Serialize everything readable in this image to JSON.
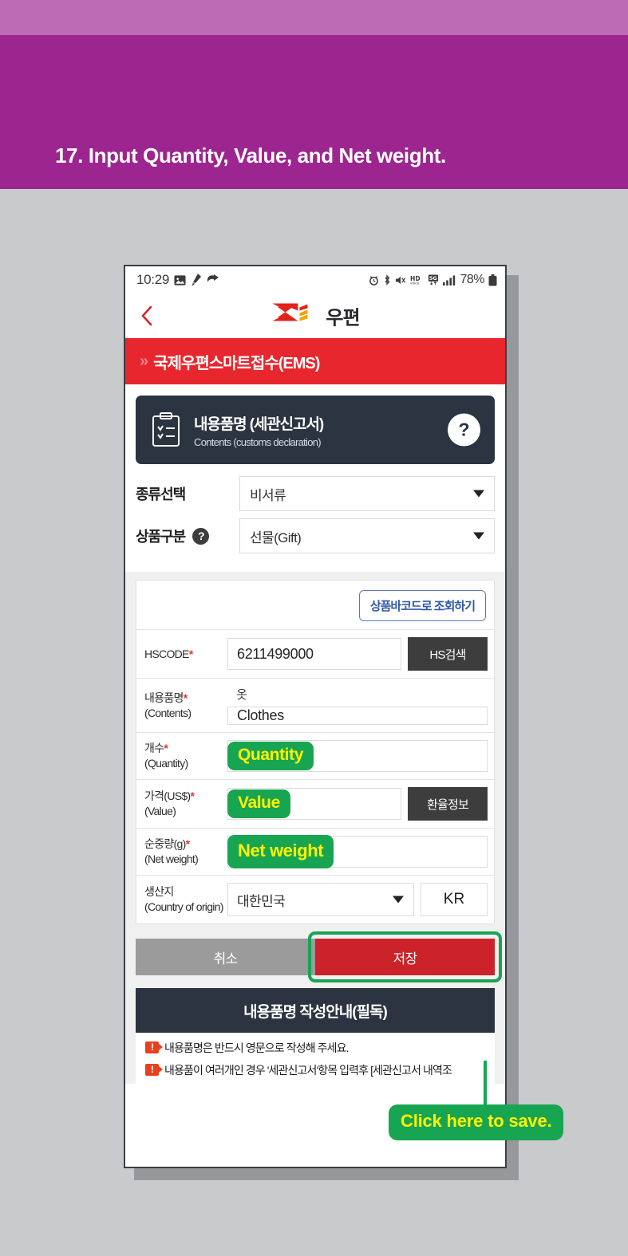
{
  "banner": {
    "title": "17. Input Quantity, Value, and Net weight."
  },
  "phone": {
    "status_bar": {
      "time": "10:29",
      "left_icons": [
        "photo-icon",
        "app-icon",
        "app-icon"
      ],
      "right_icons": [
        "alarm-icon",
        "bluetooth-icon",
        "mute-icon",
        "hd-voice-icon",
        "5g-icon",
        "signal-icon"
      ],
      "battery": "78%"
    },
    "app_bar": {
      "back_label": "‹",
      "brand_word": "우편"
    },
    "red_banner": {
      "chevrons": "»",
      "text": "국제우편스마트접수(EMS)"
    },
    "section_card": {
      "title": "내용품명 (세관신고서)",
      "subtitle": "Contents (customs declaration)",
      "help_label": "?"
    },
    "selects": [
      {
        "label": "종류선택",
        "value": "비서류",
        "has_help": false
      },
      {
        "label": "상품구분",
        "value": "선물(Gift)",
        "has_help": true,
        "help_label": "?"
      }
    ],
    "form": {
      "barcode_button": "상품바코드로 조회하기",
      "rows": {
        "hscode": {
          "label": "HSCODE",
          "required": "*",
          "value": "6211499000",
          "button": "HS검색"
        },
        "contents": {
          "label_ko": "내용품명",
          "required": "*",
          "label_en": "(Contents)",
          "value_ko": "옷",
          "value": "Clothes"
        },
        "quantity": {
          "label_ko": "개수",
          "required": "*",
          "label_en": "(Quantity)",
          "value": "",
          "annotation": "Quantity"
        },
        "value": {
          "label_ko": "가격(US$)",
          "required": "*",
          "label_en": "(Value)",
          "value": "",
          "annotation": "Value",
          "button": "환율정보"
        },
        "net_weight": {
          "label_ko": "순중량(g)",
          "required": "*",
          "label_en": "(Net weight)",
          "value": "",
          "annotation": "Net weight"
        },
        "origin": {
          "label_ko": "생산지",
          "label_en": "(Country of origin)",
          "value": "대한민국",
          "code": "KR"
        }
      }
    },
    "actions": {
      "cancel": "취소",
      "save": "저장"
    },
    "notice": {
      "heading": "내용품명 작성안내(필독)",
      "items": [
        "내용품명은 반드시 영문으로 작성해 주세요.",
        "내용품이 여러개인 경우 '세관신고서'항목 입력후 [세관신고서 내역조"
      ]
    }
  },
  "callout": {
    "text": "Click here to save."
  },
  "colors": {
    "banner_purple": "#9c258f",
    "banner_strip": "#bd6bb4",
    "post_red": "#e8262d",
    "save_red": "#cc2229",
    "dark_navy": "#2b3440",
    "annotation_green": "#17a552",
    "annotation_yellow": "#fff200",
    "page_gray": "#c9cacc"
  }
}
